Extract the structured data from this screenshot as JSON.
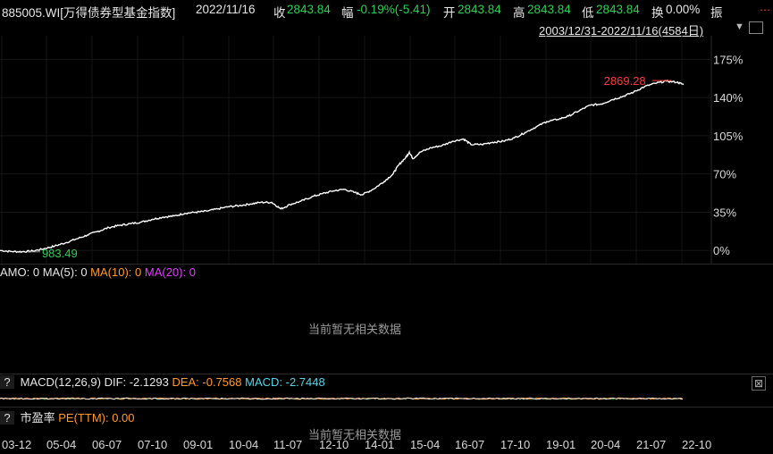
{
  "header": {
    "code_name": "885005.WI[万得债券型基金指数]",
    "date": "2022/11/16",
    "close_label": "收",
    "close_value": "2843.84",
    "change_label": "幅",
    "change_value": "-0.19%(-5.41)",
    "open_label": "开",
    "open_value": "2843.84",
    "high_label": "高",
    "high_value": "2843.84",
    "low_label": "低",
    "low_value": "2843.84",
    "turnover_label": "换",
    "turnover_value": "0.00%",
    "amplitude_label": "振"
  },
  "range": {
    "text": "2003/12/31-2022/11/16(4584日)",
    "arrow": "▼"
  },
  "chart_data": {
    "type": "line",
    "series": [
      {
        "values": [
          [
            2003.99,
            0.0
          ],
          [
            2004.3,
            -1.0
          ],
          [
            2004.6,
            -1.2
          ],
          [
            2004.9,
            -0.5
          ],
          [
            2005.2,
            1.5
          ],
          [
            2005.5,
            4.0
          ],
          [
            2005.8,
            7.0
          ],
          [
            2006.1,
            10.5
          ],
          [
            2006.4,
            14.0
          ],
          [
            2006.7,
            17.5
          ],
          [
            2007.0,
            21.0
          ],
          [
            2007.3,
            23.0
          ],
          [
            2007.6,
            24.5
          ],
          [
            2007.9,
            26.0
          ],
          [
            2008.2,
            28.5
          ],
          [
            2008.5,
            30.5
          ],
          [
            2008.8,
            31.5
          ],
          [
            2009.1,
            34.0
          ],
          [
            2009.4,
            35.0
          ],
          [
            2009.7,
            36.0
          ],
          [
            2010.0,
            38.0
          ],
          [
            2010.3,
            40.0
          ],
          [
            2010.6,
            41.0
          ],
          [
            2010.9,
            42.5
          ],
          [
            2011.2,
            44.0
          ],
          [
            2011.5,
            44.0
          ],
          [
            2011.75,
            38.0
          ],
          [
            2012.0,
            42.0
          ],
          [
            2012.3,
            45.0
          ],
          [
            2012.6,
            49.0
          ],
          [
            2012.9,
            52.0
          ],
          [
            2013.2,
            54.5
          ],
          [
            2013.5,
            56.0
          ],
          [
            2013.8,
            53.0
          ],
          [
            2014.0,
            51.0
          ],
          [
            2014.3,
            56.0
          ],
          [
            2014.6,
            63.0
          ],
          [
            2014.85,
            70.0
          ],
          [
            2015.0,
            78.0
          ],
          [
            2015.2,
            85.0
          ],
          [
            2015.3,
            90.0
          ],
          [
            2015.4,
            84.0
          ],
          [
            2015.6,
            90.0
          ],
          [
            2015.9,
            94.0
          ],
          [
            2016.2,
            96.0
          ],
          [
            2016.5,
            100.0
          ],
          [
            2016.8,
            102.0
          ],
          [
            2017.0,
            97.0
          ],
          [
            2017.3,
            97.0
          ],
          [
            2017.6,
            99.0
          ],
          [
            2017.9,
            100.0
          ],
          [
            2018.2,
            103.0
          ],
          [
            2018.5,
            108.0
          ],
          [
            2018.8,
            113.0
          ],
          [
            2019.1,
            118.0
          ],
          [
            2019.4,
            120.0
          ],
          [
            2019.7,
            123.0
          ],
          [
            2020.0,
            128.0
          ],
          [
            2020.3,
            133.0
          ],
          [
            2020.6,
            134.0
          ],
          [
            2020.9,
            138.0
          ],
          [
            2021.2,
            141.0
          ],
          [
            2021.5,
            145.0
          ],
          [
            2021.8,
            150.0
          ],
          [
            2022.1,
            153.0
          ],
          [
            2022.4,
            155.0
          ],
          [
            2022.7,
            154.0
          ],
          [
            2022.88,
            151.8
          ]
        ]
      }
    ],
    "y_ticks": [
      "175%",
      "140%",
      "105%",
      "70%",
      "35%",
      "0%"
    ],
    "ylim": [
      -8,
      190
    ],
    "xlim": [
      2003.99,
      2023.6
    ],
    "x_ticks": [
      "03-12",
      "05-04",
      "06-07",
      "07-10",
      "09-01",
      "10-04",
      "11-07",
      "12-10",
      "14-01",
      "15-04",
      "16-07",
      "17-10",
      "19-01",
      "20-04",
      "21-07",
      "22-10"
    ],
    "annotations": [
      {
        "text": "2869.28",
        "color": "#ff3b3b"
      },
      {
        "text": "983.49",
        "color": "#2fcf55"
      }
    ]
  },
  "volume": {
    "amo": "AMO: 0",
    "ma5": "MA(5): 0",
    "ma10": "MA(10): 0",
    "ma20": "MA(20): 0",
    "no_data": "当前暂无相关数据"
  },
  "macd": {
    "q": "?",
    "title": "MACD(12,26,9)",
    "dif": "DIF: -2.1293",
    "dea": "DEA: -0.7568",
    "macd": "MACD: -2.7448",
    "close": "⊠"
  },
  "pe": {
    "q": "?",
    "title": "市盈率",
    "value": "PE(TTM): 0.00",
    "no_data": "当前暂无相关数据"
  },
  "colors": {
    "red": "#ff3b3b",
    "green": "#2fcf55",
    "orange": "#ff9a2e",
    "magenta": "#e040fb",
    "cyan": "#59d5e6"
  }
}
